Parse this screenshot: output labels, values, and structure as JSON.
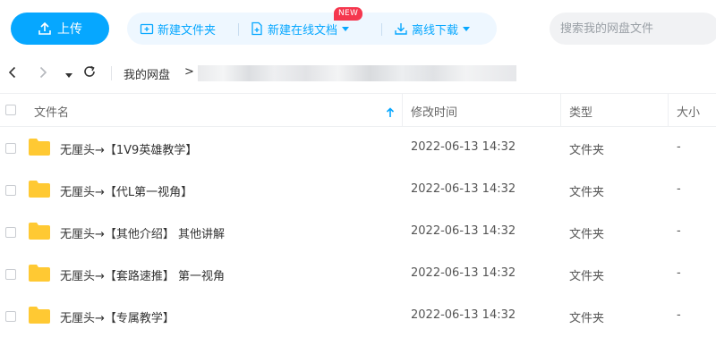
{
  "toolbar": {
    "upload_label": "上传",
    "new_folder_label": "新建文件夹",
    "new_online_doc_label": "新建在线文档",
    "new_badge": "NEW",
    "offline_download_label": "离线下载",
    "search_placeholder": "搜索我的网盘文件"
  },
  "breadcrumb": {
    "root": "我的网盘",
    "separator": ">"
  },
  "table": {
    "headers": {
      "name": "文件名",
      "modified": "修改时间",
      "type": "类型",
      "size": "大小"
    },
    "rows": [
      {
        "name": "无厘头→【1V9英雄教学】",
        "modified": "2022-06-13 14:32",
        "type": "文件夹",
        "size": "-"
      },
      {
        "name": "无厘头→【代L第一视角】",
        "modified": "2022-06-13 14:32",
        "type": "文件夹",
        "size": "-"
      },
      {
        "name": "无厘头→【其他介绍】 其他讲解",
        "modified": "2022-06-13 14:32",
        "type": "文件夹",
        "size": "-"
      },
      {
        "name": "无厘头→【套路速推】 第一视角",
        "modified": "2022-06-13 14:32",
        "type": "文件夹",
        "size": "-"
      },
      {
        "name": "无厘头→【专属教学】",
        "modified": "2022-06-13 14:32",
        "type": "文件夹",
        "size": "-"
      }
    ]
  },
  "icons": {
    "upload": "upload-icon",
    "new_folder": "folder-plus-icon",
    "new_doc": "doc-plus-icon",
    "offline_download": "download-icon",
    "folder": "folder-icon"
  },
  "colors": {
    "accent": "#06a7ff",
    "folder": "#ffc933",
    "badge": "#f5374e"
  }
}
